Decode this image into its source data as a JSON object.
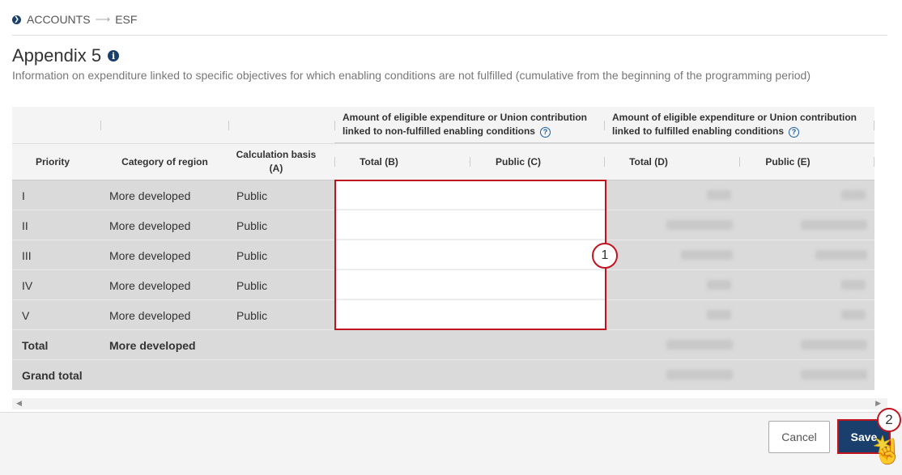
{
  "breadcrumb": {
    "items": [
      "ACCOUNTS",
      "ESF"
    ]
  },
  "page": {
    "title": "Appendix 5",
    "description": "Information on expenditure linked to specific objectives for which enabling conditions are not fulfilled (cumulative from the beginning of the programming period)"
  },
  "table": {
    "groups": {
      "non_fulfilled": "Amount of eligible expenditure or Union contribution linked to non-fulfilled enabling conditions",
      "fulfilled": "Amount of eligible expenditure or Union contribution linked to fulfilled enabling conditions"
    },
    "headers": {
      "priority": "Priority",
      "category": "Category of region",
      "calc_basis": "Calculation basis (A)",
      "total_b": "Total (B)",
      "public_c": "Public (C)",
      "total_d": "Total (D)",
      "public_e": "Public (E)"
    },
    "rows": [
      {
        "priority": "I",
        "category": "More developed",
        "basis": "Public"
      },
      {
        "priority": "II",
        "category": "More developed",
        "basis": "Public"
      },
      {
        "priority": "III",
        "category": "More developed",
        "basis": "Public"
      },
      {
        "priority": "IV",
        "category": "More developed",
        "basis": "Public"
      },
      {
        "priority": "V",
        "category": "More developed",
        "basis": "Public"
      }
    ],
    "total_row": {
      "label": "Total",
      "category": "More developed"
    },
    "grand_total_row": {
      "label": "Grand total"
    }
  },
  "callouts": {
    "one": "1",
    "two": "2"
  },
  "buttons": {
    "cancel": "Cancel",
    "save": "Save"
  },
  "colors": {
    "primary": "#1a3f6d",
    "highlight": "#c0141f"
  },
  "icons": [
    "chevron-right-icon",
    "arrow-right-icon",
    "info-icon",
    "help-icon",
    "hand-cursor-icon"
  ]
}
